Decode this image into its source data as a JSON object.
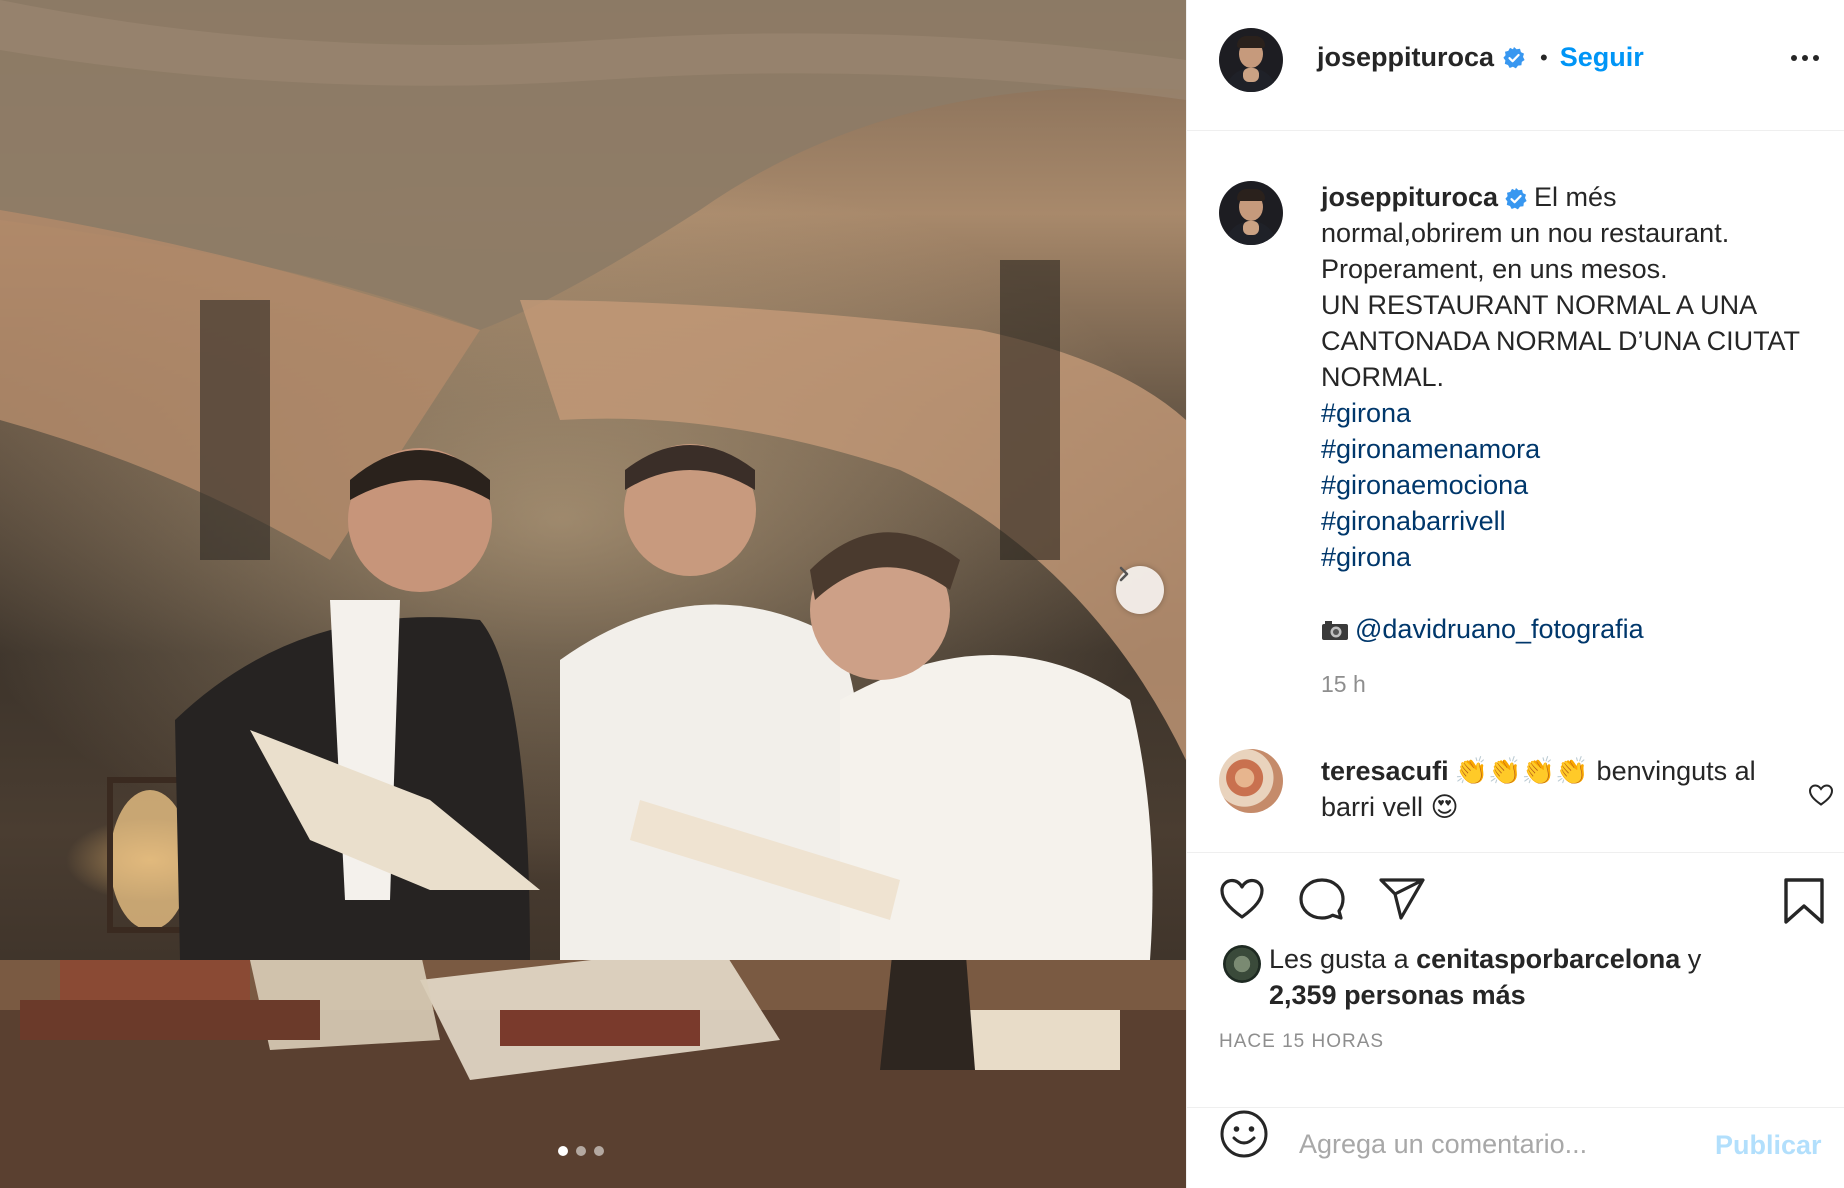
{
  "post": {
    "images_count": 3,
    "current_image": 1
  },
  "header": {
    "username": "joseppituroca",
    "separator": "•",
    "follow_label": "Seguir"
  },
  "caption": {
    "username": "joseppituroca",
    "lines": [
      "El més",
      "normal,obrirem un nou restaurant.",
      "Properament, en uns mesos.",
      "UN RESTAURANT NORMAL A UNA",
      "CANTONADA NORMAL D’UNA CIUTAT",
      "NORMAL."
    ],
    "hashtags": [
      "#girona",
      "#gironamenamora",
      "#gironaemociona",
      "#gironabarrivell",
      "#girona"
    ],
    "mention": "@davidruano_fotografia",
    "time": "15 h"
  },
  "comment": {
    "username": "teresacufi",
    "text_a": "👏👏👏👏 benvinguts al",
    "text_b": "barri vell 😍"
  },
  "likes": {
    "prefix": "Les gusta a",
    "user": "cenitasporbarcelona",
    "suffix": "y",
    "others": "2,359 personas más"
  },
  "posted_ago": "HACE 15 HORAS",
  "add_comment": {
    "placeholder": "Agrega un comentario...",
    "publish_label": "Publicar"
  },
  "colors": {
    "accent": "#0095f6",
    "link": "#00376b",
    "muted": "#8e8e8e",
    "publish_disabled": "#b2dffc"
  },
  "icons": [
    "verified-badge-icon",
    "more-options-icon",
    "next-arrow-icon",
    "heart-icon",
    "comment-icon",
    "share-icon",
    "bookmark-icon",
    "emoji-icon",
    "camera-icon"
  ]
}
